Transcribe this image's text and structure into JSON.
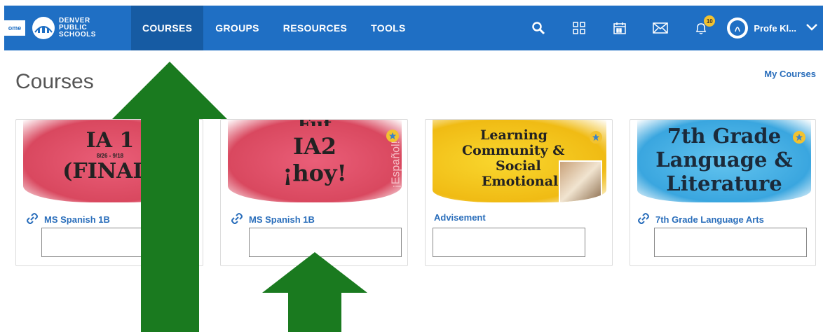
{
  "header": {
    "home_label": "ome",
    "logo_text": [
      "DENVER",
      "PUBLIC",
      "SCHOOLS"
    ],
    "nav": [
      "COURSES",
      "GROUPS",
      "RESOURCES",
      "TOOLS"
    ],
    "notification_count": "10",
    "user_name": "Profe Kl..."
  },
  "page": {
    "title": "Courses",
    "my_courses_link": "My Courses"
  },
  "cards": [
    {
      "img_lines": [
        "IA 1",
        "8/26 - 9/18",
        "(FINAL)"
      ],
      "img_color": "#e2546e",
      "link": "MS Spanish 1B",
      "has_link_icon": true
    },
    {
      "img_lines": [
        "Fut",
        "IA2",
        "¡hoy!"
      ],
      "img_side_text": "¡Español!",
      "img_color": "#e2546e",
      "link": "MS Spanish 1B",
      "has_link_icon": true
    },
    {
      "img_lines": [
        "Learning",
        "Community &",
        "Social",
        "Emotional"
      ],
      "img_color": "#f4c81f",
      "link": "Advisement",
      "has_link_icon": false
    },
    {
      "img_lines": [
        "7th Grade",
        "Language &",
        "Literature"
      ],
      "img_color": "#52b6e6",
      "link": "7th Grade Language Arts",
      "has_link_icon": true
    }
  ],
  "colors": {
    "header_blue": "#1f6fc4",
    "arrow_green": "#1a7a1f",
    "link_blue": "#2a6ebb"
  }
}
